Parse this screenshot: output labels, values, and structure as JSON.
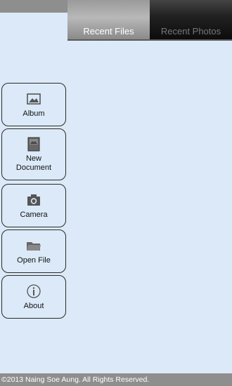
{
  "tabs": {
    "recent_files": "Recent Files",
    "recent_photos": "Recent Photos"
  },
  "sidebar": {
    "album": "Album",
    "new_document_line1": "New",
    "new_document_line2": "Document",
    "camera": "Camera",
    "open_file": "Open File",
    "about": "About"
  },
  "footer": {
    "copyright": "©2013 Naing Soe Aung. All Rights Reserved."
  },
  "colors": {
    "background": "#dbe9f8",
    "active_tab": "#9a9a9a",
    "inactive_tab": "#1a1a1a"
  },
  "icons": {
    "album": "image-icon",
    "new_document": "document-icon",
    "camera": "camera-icon",
    "open_file": "folder-icon",
    "about": "info-icon"
  }
}
